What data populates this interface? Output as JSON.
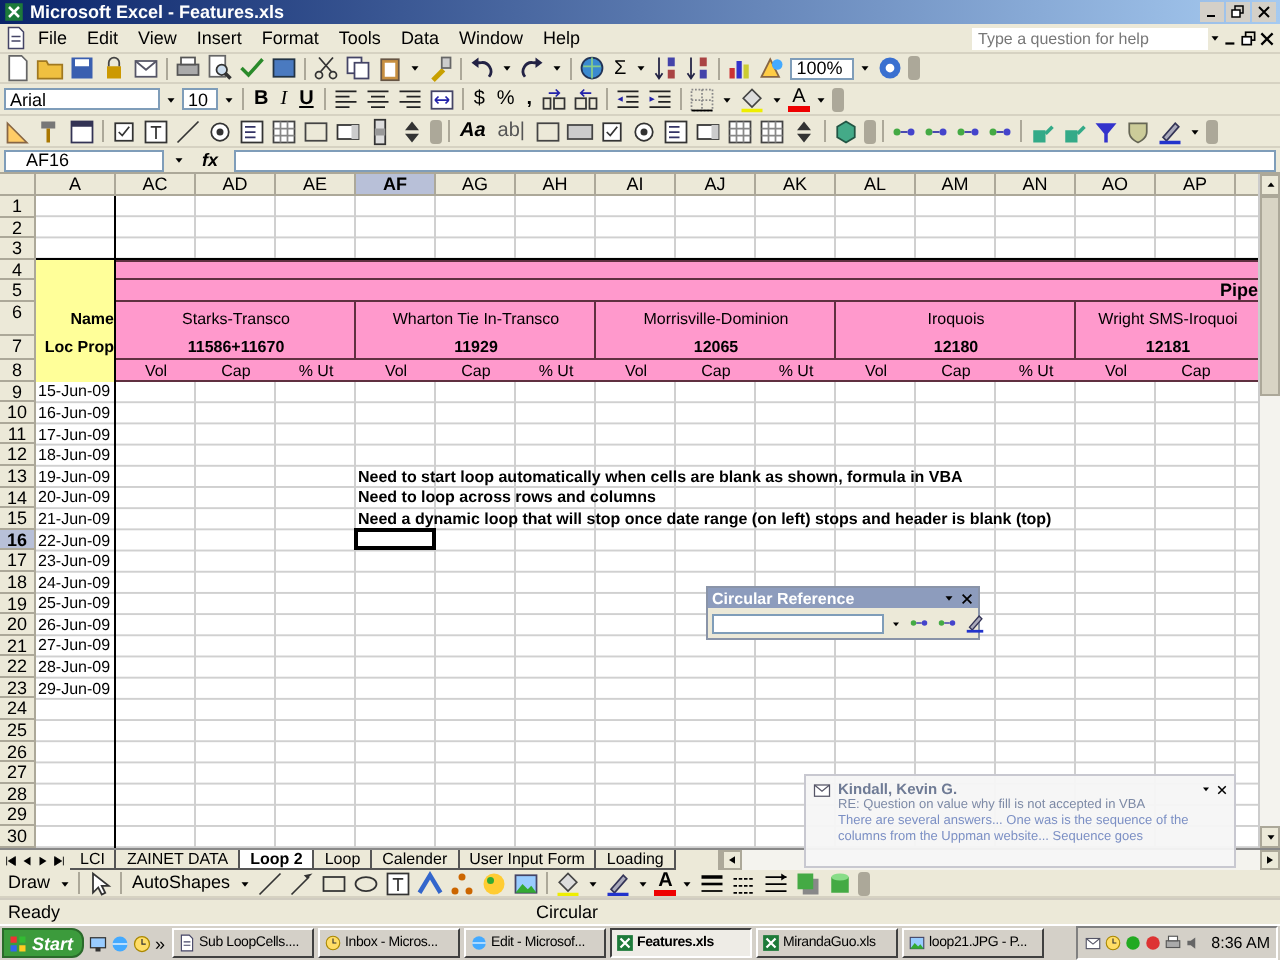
{
  "window": {
    "title": "Microsoft Excel - Features.xls"
  },
  "menu": [
    "File",
    "Edit",
    "View",
    "Insert",
    "Format",
    "Tools",
    "Data",
    "Window",
    "Help"
  ],
  "help_search": {
    "placeholder": "Type a question for help"
  },
  "standard_toolbar": {
    "autosum": "Σ",
    "zoom": "100%"
  },
  "formatting_toolbar": {
    "font": "Arial",
    "size": "10",
    "style_buttons": [
      "B",
      "I",
      "U"
    ],
    "number_buttons": [
      "$",
      "%",
      ","
    ],
    "font_color": "A"
  },
  "forms_toolbar": {
    "label_button": "Aa",
    "edit_button": "ab|"
  },
  "formula_bar": {
    "name_box": "AF16",
    "function_label": "fx"
  },
  "sheet": {
    "columns": [
      {
        "label": "A",
        "selected": false
      },
      {
        "label": "AC",
        "selected": false
      },
      {
        "label": "AD",
        "selected": false
      },
      {
        "label": "AE",
        "selected": false
      },
      {
        "label": "AF",
        "selected": true
      },
      {
        "label": "AG",
        "selected": false
      },
      {
        "label": "AH",
        "selected": false
      },
      {
        "label": "AI",
        "selected": false
      },
      {
        "label": "AJ",
        "selected": false
      },
      {
        "label": "AK",
        "selected": false
      },
      {
        "label": "AL",
        "selected": false
      },
      {
        "label": "AM",
        "selected": false
      },
      {
        "label": "AN",
        "selected": false
      },
      {
        "label": "AO",
        "selected": false
      },
      {
        "label": "AP",
        "selected": false
      }
    ],
    "rows": [
      {
        "label": "1",
        "selected": false
      },
      {
        "label": "2",
        "selected": false
      },
      {
        "label": "3",
        "selected": false
      },
      {
        "label": "4",
        "selected": false
      },
      {
        "label": "5",
        "selected": false
      },
      {
        "label": "6",
        "selected": false
      },
      {
        "label": "7",
        "selected": false
      },
      {
        "label": "8",
        "selected": false
      },
      {
        "label": "9",
        "selected": false
      },
      {
        "label": "10",
        "selected": false
      },
      {
        "label": "11",
        "selected": false
      },
      {
        "label": "12",
        "selected": false
      },
      {
        "label": "13",
        "selected": false
      },
      {
        "label": "14",
        "selected": false
      },
      {
        "label": "15",
        "selected": false
      },
      {
        "label": "16",
        "selected": true
      },
      {
        "label": "17",
        "selected": false
      },
      {
        "label": "18",
        "selected": false
      },
      {
        "label": "19",
        "selected": false
      },
      {
        "label": "20",
        "selected": false
      },
      {
        "label": "21",
        "selected": false
      },
      {
        "label": "22",
        "selected": false
      },
      {
        "label": "23",
        "selected": false
      },
      {
        "label": "24",
        "selected": false
      },
      {
        "label": "25",
        "selected": false
      },
      {
        "label": "26",
        "selected": false
      },
      {
        "label": "27",
        "selected": false
      },
      {
        "label": "28",
        "selected": false
      },
      {
        "label": "29",
        "selected": false
      },
      {
        "label": "30",
        "selected": false
      }
    ],
    "header_block": {
      "name_label": "Name",
      "loc_label": "Loc Prop",
      "pipe_label": "Pipe",
      "groups": [
        {
          "name": "Starks-Transco",
          "loc": "11586+11670",
          "subheaders": [
            "Vol",
            "Cap",
            "% Ut"
          ]
        },
        {
          "name": "Wharton Tie In-Transco",
          "loc": "11929",
          "subheaders": [
            "Vol",
            "Cap",
            "% Ut"
          ]
        },
        {
          "name": "Morrisville-Dominion",
          "loc": "12065",
          "subheaders": [
            "Vol",
            "Cap",
            "% Ut"
          ]
        },
        {
          "name": "Iroquois",
          "loc": "12180",
          "subheaders": [
            "Vol",
            "Cap",
            "% Ut"
          ]
        },
        {
          "name": "Wright SMS-Iroquoi",
          "loc": "12181",
          "subheaders": [
            "Vol",
            "Cap"
          ]
        }
      ]
    },
    "dates": [
      "15-Jun-09",
      "16-Jun-09",
      "17-Jun-09",
      "18-Jun-09",
      "19-Jun-09",
      "20-Jun-09",
      "21-Jun-09",
      "22-Jun-09",
      "23-Jun-09",
      "24-Jun-09",
      "25-Jun-09",
      "26-Jun-09",
      "27-Jun-09",
      "28-Jun-09",
      "29-Jun-09"
    ],
    "notes": [
      "Need to start loop automatically when cells are blank as shown, formula in VBA",
      "Need to loop across rows and columns",
      "Need a dynamic loop that will stop once date range (on left) stops and header is blank (top)"
    ]
  },
  "sheet_tabs": [
    {
      "label": "LCI",
      "selected": false
    },
    {
      "label": "ZAINET DATA",
      "selected": false
    },
    {
      "label": "Loop 2",
      "selected": true
    },
    {
      "label": "Loop",
      "selected": false
    },
    {
      "label": "Calender",
      "selected": false
    },
    {
      "label": "User Input Form",
      "selected": false
    },
    {
      "label": "Loading",
      "selected": false
    }
  ],
  "drawing_toolbar": {
    "draw": "Draw",
    "autoshapes": "AutoShapes",
    "font_color": "A"
  },
  "status_bar": {
    "mode": "Ready",
    "circular": "Circular"
  },
  "circular_reference": {
    "title": "Circular Reference"
  },
  "alert": {
    "sender": "Kindall, Kevin G.",
    "subject": "RE: Question on value why fill is not accepted in VBA",
    "preview": "There are several answers... One was is the sequence of the columns from the Uppman website... Sequence goes"
  },
  "taskbar": {
    "start": "Start",
    "chevron": "»",
    "clock": "8:36 AM",
    "tasks": [
      {
        "label": "Sub LoopCells....",
        "selected": false
      },
      {
        "label": "Inbox - Micros...",
        "selected": false
      },
      {
        "label": "Edit - Microsof...",
        "selected": false
      },
      {
        "label": "Features.xls",
        "selected": true
      },
      {
        "label": "MirandaGuo.xls",
        "selected": false
      },
      {
        "label": "loop21.JPG - P...",
        "selected": false
      }
    ]
  }
}
